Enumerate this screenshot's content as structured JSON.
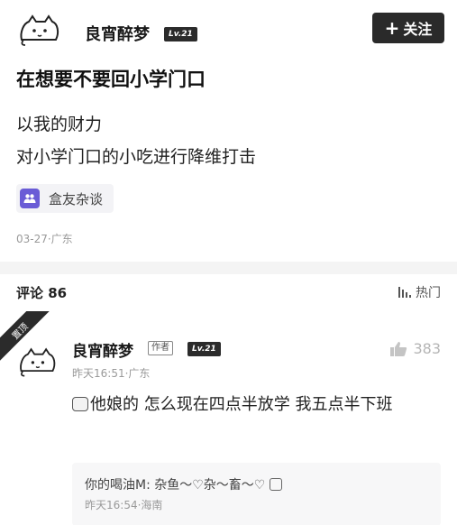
{
  "post": {
    "author": {
      "name": "良宵醉梦",
      "level": "Lv.21"
    },
    "follow_label": "关注",
    "title": "在想要不要回小学门口",
    "body_lines": [
      "以我的财力",
      "对小学门口的小吃进行降维打击"
    ],
    "topic": "盒友杂谈",
    "meta": "03-27·广东"
  },
  "comments_section": {
    "title": "评论 86",
    "sort_label": "热门"
  },
  "comment": {
    "pinned_label": "置顶",
    "author": "良宵醉梦",
    "author_tag": "作者",
    "level": "Lv.21",
    "likes": "383",
    "meta": "昨天16:51·广东",
    "text": "他娘的 怎么现在四点半放学 我五点半下班",
    "reply": {
      "text": "你的喝油M: 杂鱼～♡杂～畜～♡",
      "meta": "昨天16:54·海南"
    }
  },
  "icons": {
    "avatar": "cat-doodle-icon",
    "follow": "plus-icon",
    "topic": "group-icon",
    "sort": "sort-bars-icon",
    "like": "thumbs-up-icon",
    "emoji": "emoji-face-icon"
  }
}
